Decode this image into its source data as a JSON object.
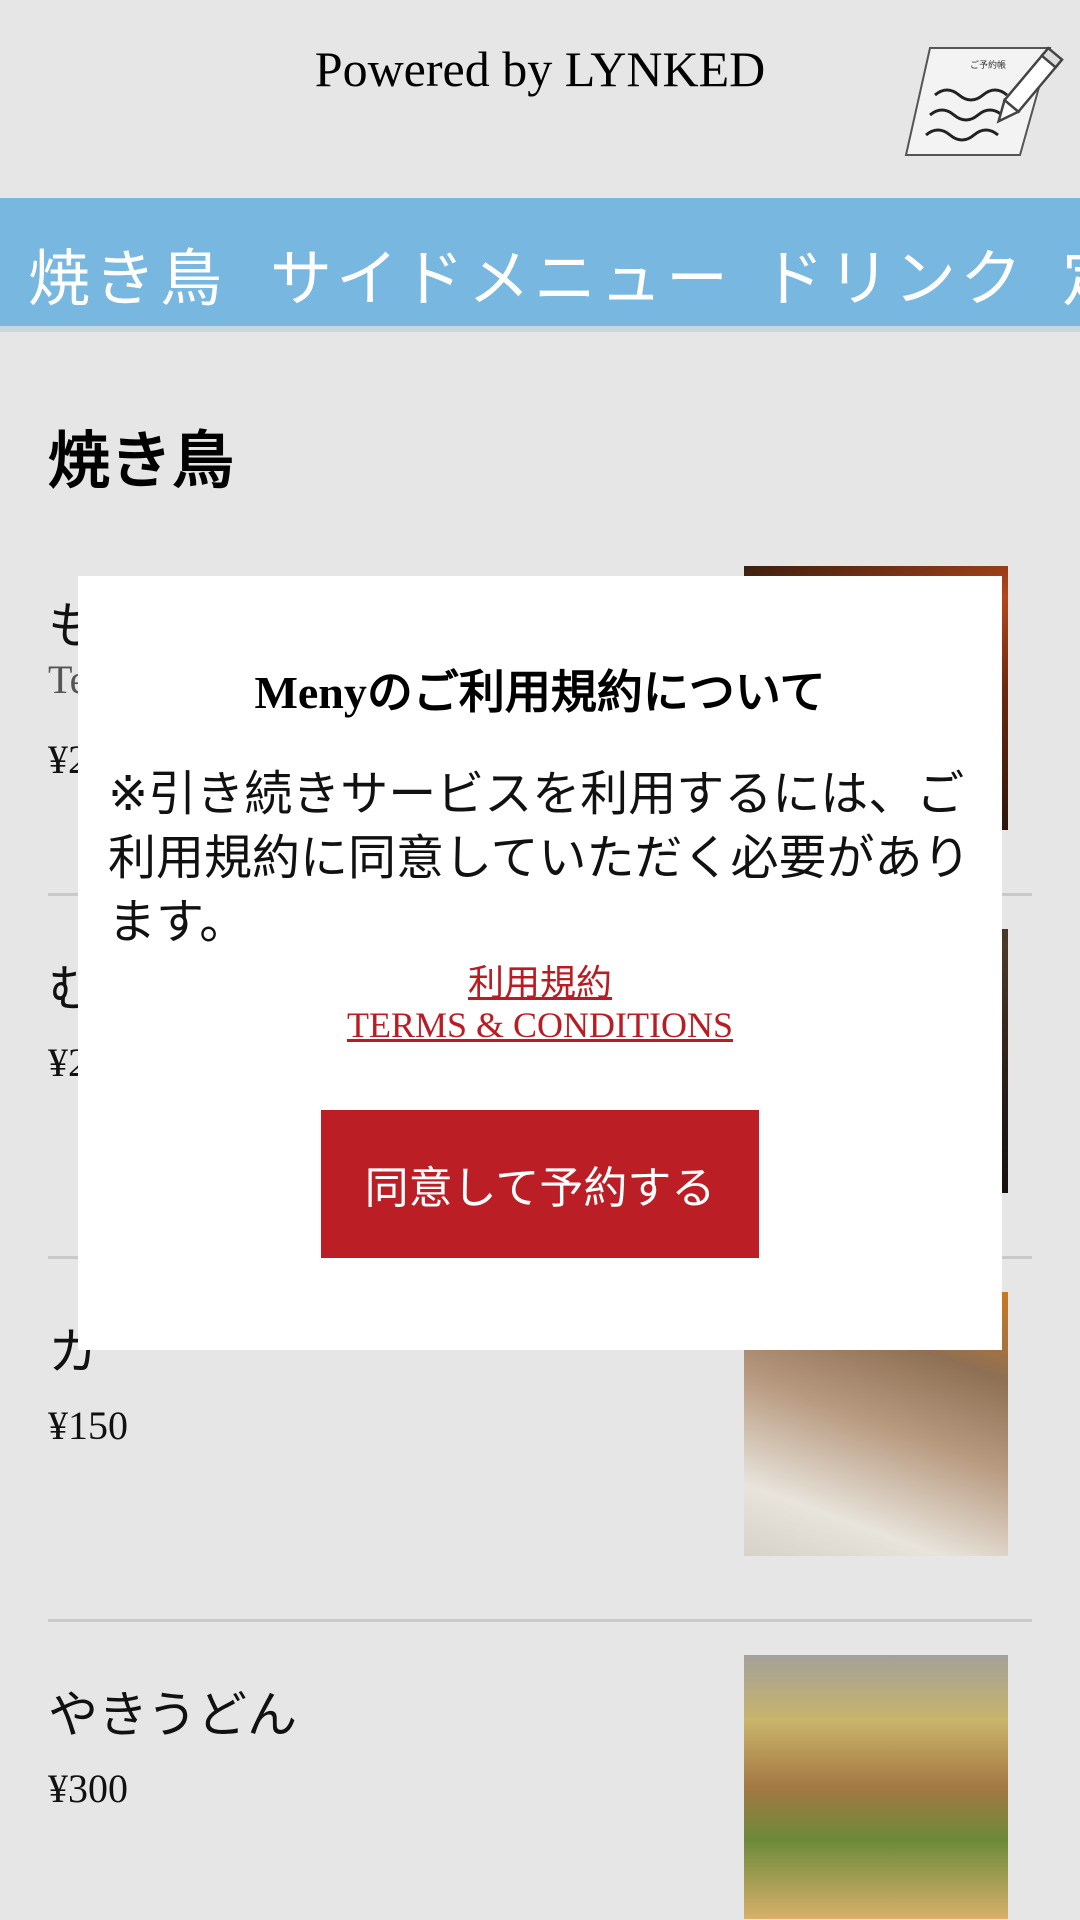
{
  "header": {
    "powered_by": "Powered by LYNKED",
    "reserve_icon_label": "ご予約帳"
  },
  "tabs": [
    {
      "label": "焼き鳥"
    },
    {
      "label": "サイドメニュー"
    },
    {
      "label": "ドリンク"
    },
    {
      "label": "定"
    }
  ],
  "section": {
    "title": "焼き鳥"
  },
  "menu": {
    "items": [
      {
        "name": "も",
        "desc": "Te",
        "price": "¥2"
      },
      {
        "name": "む",
        "price": "¥2"
      },
      {
        "name": "カ",
        "price": "¥150"
      },
      {
        "name": "やきうどん",
        "price": "¥300"
      }
    ]
  },
  "modal": {
    "title": "Menyのご利用規約について",
    "body": "※引き続きサービスを利用するには、ご利用規約に同意していただく必要があります。",
    "terms_ja": "利用規約",
    "terms_en": "TERMS & CONDITIONS",
    "agree_button": "同意して予約する"
  },
  "colors": {
    "tab_bar": "#77b7e0",
    "accent_red": "#bb1e24",
    "background": "#e6e6e6"
  }
}
